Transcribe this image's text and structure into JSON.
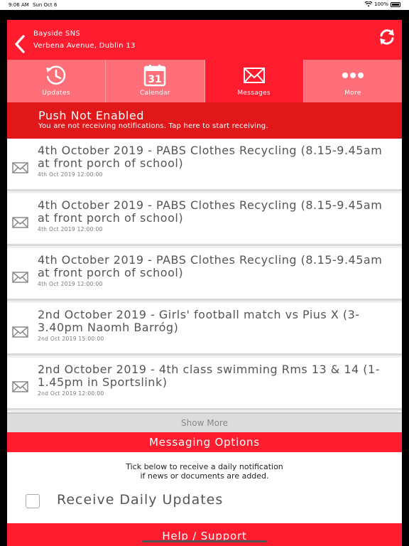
{
  "status_bar": {
    "time": "9:06 AM",
    "date": "Sun Oct 6",
    "battery": "100%"
  },
  "header": {
    "school_name": "Bayside SNS",
    "address": "Verbena Avenue, Dublin 13"
  },
  "tabs": [
    {
      "label": "Updates",
      "icon": "clock-refresh-icon"
    },
    {
      "label": "Calendar",
      "icon": "calendar-icon",
      "day": "31"
    },
    {
      "label": "Messages",
      "icon": "envelope-icon",
      "active": true
    },
    {
      "label": "More",
      "icon": "more-dots-icon"
    }
  ],
  "push_banner": {
    "title": "Push Not Enabled",
    "subtitle": "You are not receiving notifications. Tap here to start receiving."
  },
  "messages": [
    {
      "title": "4th October 2019 - PABS Clothes Recycling (8.15-9.45am at front porch of school)",
      "date": "4th Oct 2019 12:00:00"
    },
    {
      "title": "4th October 2019 - PABS Clothes Recycling (8.15-9.45am at front porch of school)",
      "date": "4th Oct 2019 12:00:00"
    },
    {
      "title": "4th October 2019 - PABS Clothes Recycling (8.15-9.45am at front porch of school)",
      "date": "4th Oct 2019 12:00:00"
    },
    {
      "title": "2nd October 2019 - Girls' football match vs Pius X (3-3.40pm Naomh Barróg)",
      "date": "2nd Oct 2019 15:00:00"
    },
    {
      "title": "2nd October 2019 - 4th class swimming Rms 13 & 14 (1-1.45pm in Sportslink)",
      "date": "2nd Oct 2019 12:00:00"
    }
  ],
  "show_more_label": "Show More",
  "messaging_options": {
    "header": "Messaging Options",
    "description_line1": "Tick below to receive a daily notification",
    "description_line2": "if news or documents are added.",
    "checkbox_label": "Receive Daily Updates",
    "checked": false
  },
  "help_header": "Help / Support",
  "colors": {
    "brand_red": "#ff1c2e",
    "banner_red": "#e0181a",
    "tab_inactive": "#ff6f7a"
  }
}
